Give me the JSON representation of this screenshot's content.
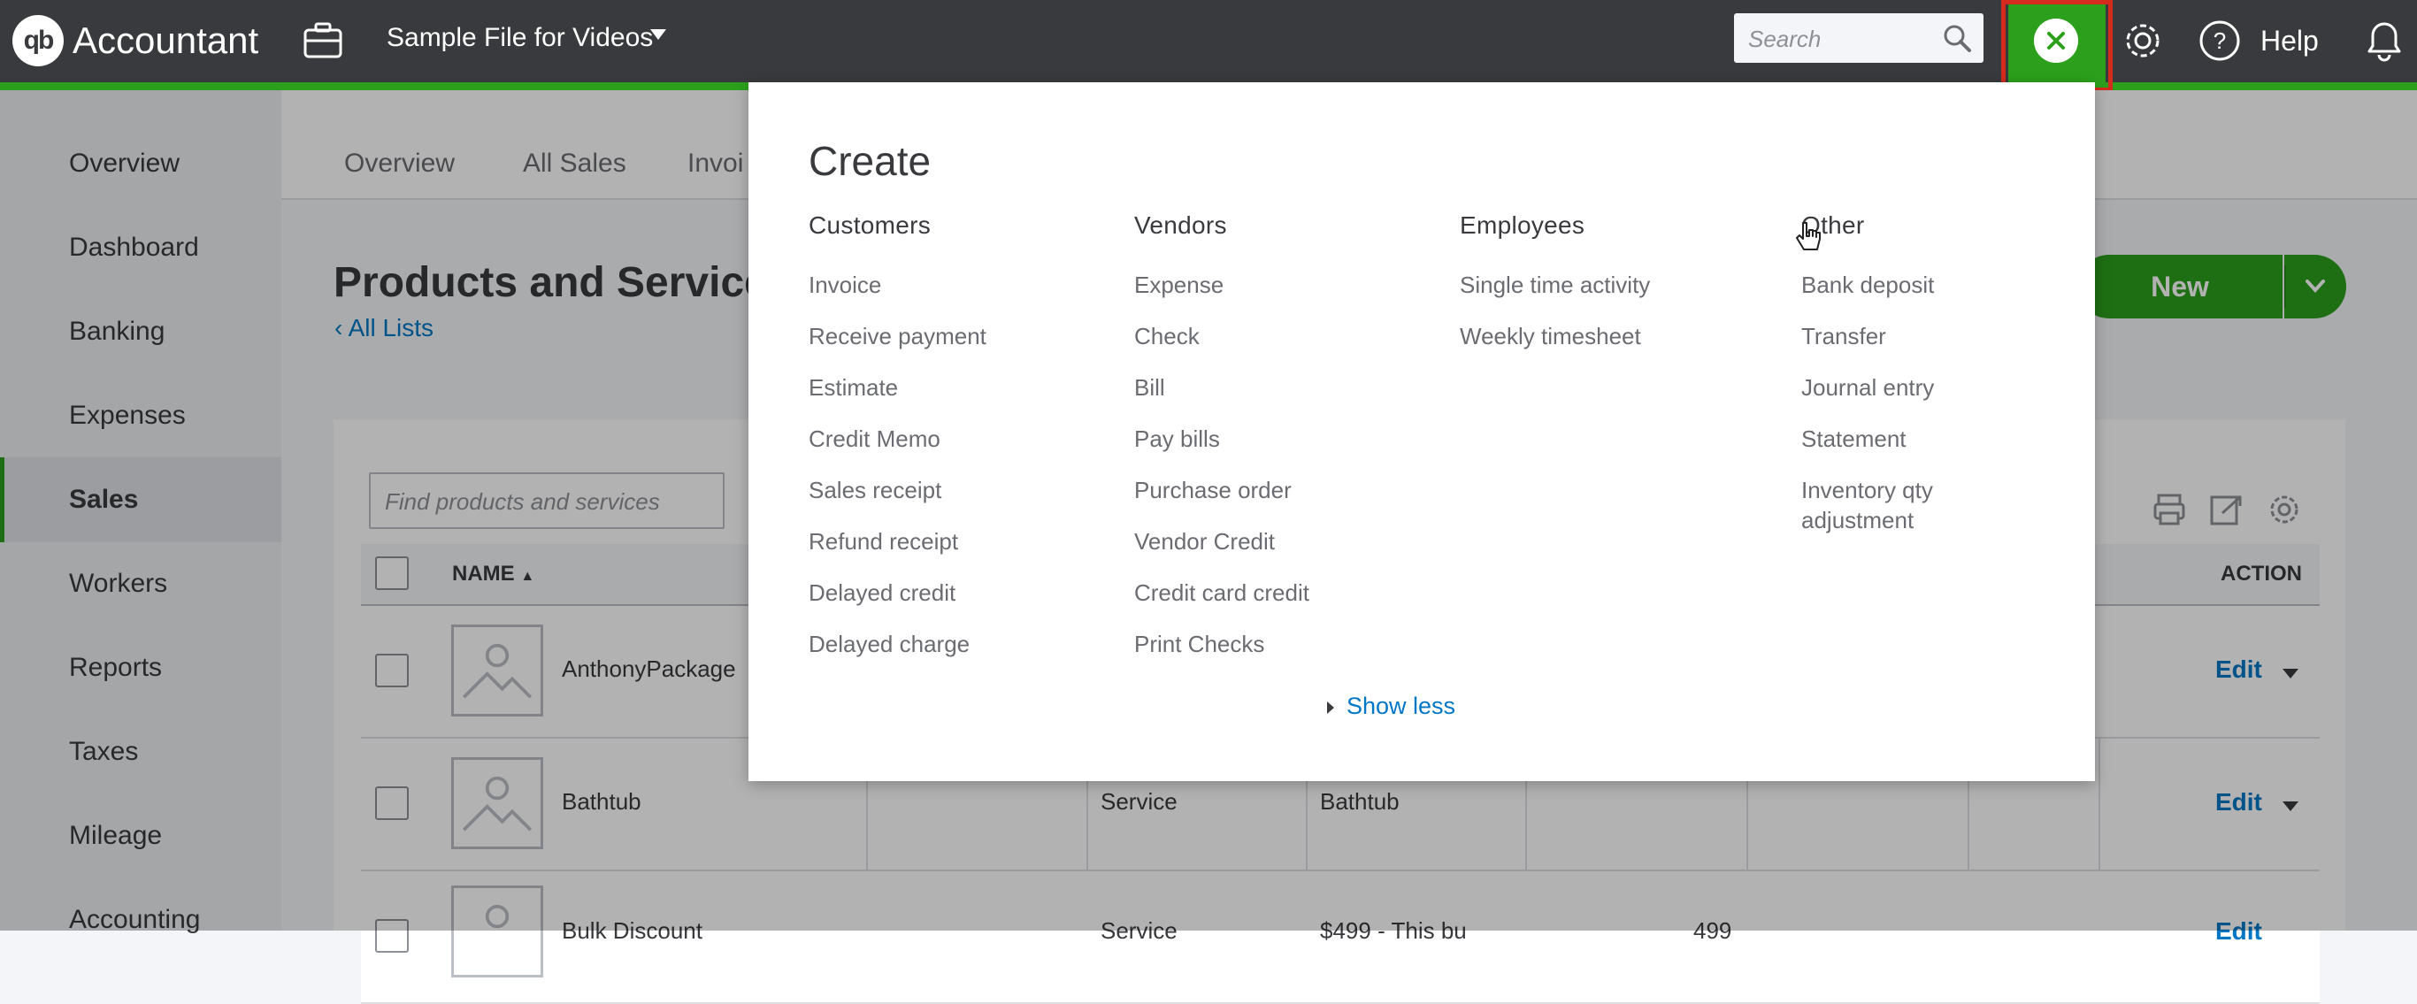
{
  "header": {
    "brand": "Accountant",
    "logo_text": "qb",
    "company": "Sample File for Videos",
    "search_placeholder": "Search",
    "help_label": "Help"
  },
  "sidebar": {
    "items": [
      "Overview",
      "Dashboard",
      "Banking",
      "Expenses",
      "Sales",
      "Workers",
      "Reports",
      "Taxes",
      "Mileage",
      "Accounting"
    ],
    "active": "Sales"
  },
  "subnav": {
    "tabs": [
      "Overview",
      "All Sales",
      "Invoi"
    ]
  },
  "page": {
    "title": "Products and Service",
    "back_link": "All Lists",
    "new_button": "New",
    "find_placeholder": "Find products and services"
  },
  "table": {
    "headers": {
      "name": "NAME",
      "action": "ACTION"
    },
    "rows": [
      {
        "name": "AnthonyPackage",
        "type": "",
        "description": "",
        "price": "",
        "action": "Edit"
      },
      {
        "name": "Bathtub",
        "type": "Service",
        "description": "Bathtub",
        "price": "",
        "action": "Edit"
      },
      {
        "name": "Bulk Discount",
        "type": "Service",
        "description": "$499 - This bu",
        "price": "499",
        "action": "Edit"
      }
    ]
  },
  "create_menu": {
    "title": "Create",
    "columns": [
      {
        "heading": "Customers",
        "items": [
          "Invoice",
          "Receive payment",
          "Estimate",
          "Credit Memo",
          "Sales receipt",
          "Refund receipt",
          "Delayed credit",
          "Delayed charge"
        ]
      },
      {
        "heading": "Vendors",
        "items": [
          "Expense",
          "Check",
          "Bill",
          "Pay bills",
          "Purchase order",
          "Vendor Credit",
          "Credit card credit",
          "Print Checks"
        ]
      },
      {
        "heading": "Employees",
        "items": [
          "Single time activity",
          "Weekly timesheet"
        ]
      },
      {
        "heading": "Other",
        "items": [
          "Bank deposit",
          "Transfer",
          "Journal entry",
          "Statement",
          "Inventory qty adjustment"
        ]
      }
    ],
    "show_less": "Show less"
  },
  "colors": {
    "brand_green": "#2ca01c",
    "header_bg": "#393a3d",
    "link_blue": "#0077c5",
    "highlight_red": "#d52b1e"
  }
}
